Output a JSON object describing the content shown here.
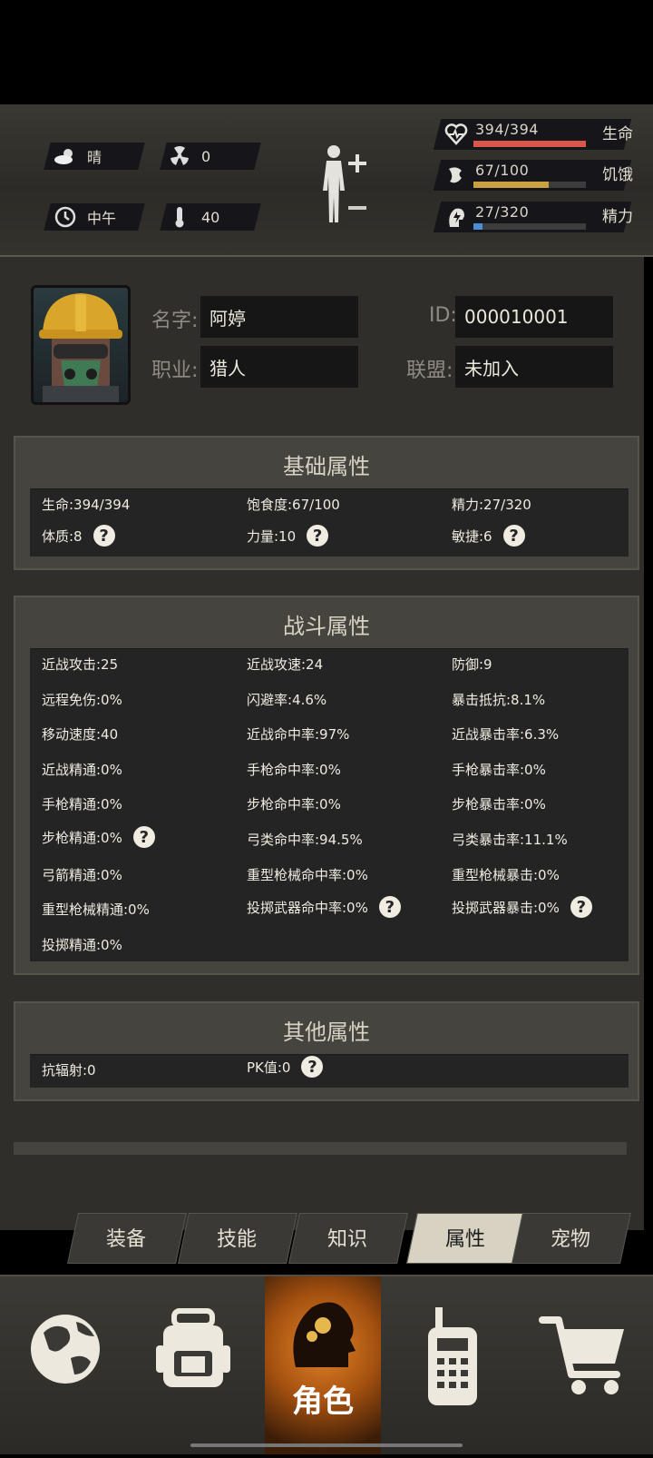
{
  "status": {
    "weather": {
      "icon": "cloud-sun-icon",
      "label": "晴"
    },
    "radiation": {
      "icon": "radiation-icon",
      "value": "0"
    },
    "time": {
      "icon": "clock-icon",
      "label": "中午"
    },
    "temperature": {
      "icon": "thermometer-icon",
      "value": "40"
    }
  },
  "vitals": [
    {
      "icon": "heart-icon",
      "value": "394/394",
      "label": "生命",
      "fill": 1.0,
      "color": "#d9574a"
    },
    {
      "icon": "hunger-icon",
      "value": "67/100",
      "label": "饥饿",
      "fill": 0.67,
      "color": "#c9a23f"
    },
    {
      "icon": "energy-icon",
      "value": "27/320",
      "label": "精力",
      "fill": 0.084,
      "color": "#4b8ed1"
    }
  ],
  "profile": {
    "name_label": "名字:",
    "name": "阿婷",
    "id_label": "ID:",
    "id": "000010001",
    "job_label": "职业:",
    "job": "猎人",
    "alliance_label": "联盟:",
    "alliance": "未加入"
  },
  "basic": {
    "title": "基础属性",
    "rows": [
      [
        "生命:394/394",
        "饱食度:67/100",
        "精力:27/320"
      ],
      [
        "体质:8",
        "力量:10",
        "敏捷:6"
      ]
    ]
  },
  "combat": {
    "title": "战斗属性",
    "rows": [
      [
        "近战攻击:25",
        "近战攻速:24",
        "防御:9"
      ],
      [
        "远程免伤:0%",
        "闪避率:4.6%",
        "暴击抵抗:8.1%"
      ],
      [
        "移动速度:40",
        "近战命中率:97%",
        "近战暴击率:6.3%"
      ],
      [
        "近战精通:0%",
        "手枪命中率:0%",
        "手枪暴击率:0%"
      ],
      [
        "手枪精通:0%",
        "步枪命中率:0%",
        "步枪暴击率:0%"
      ],
      [
        "步枪精通:0%",
        "弓类命中率:94.5%",
        "弓类暴击率:11.1%"
      ],
      [
        "弓箭精通:0%",
        "重型枪械命中率:0%",
        "重型枪械暴击:0%"
      ],
      [
        "重型枪械精通:0%",
        "投掷武器命中率:0%",
        "投掷武器暴击:0%"
      ],
      [
        "投掷精通:0%"
      ]
    ]
  },
  "other": {
    "title": "其他属性",
    "rows": [
      [
        "抗辐射:0",
        "PK值:0"
      ]
    ]
  },
  "subtabs": [
    "装备",
    "技能",
    "知识",
    "属性",
    "宠物"
  ],
  "active_subtab": "属性",
  "nav": [
    {
      "icon": "globe-icon",
      "label": ""
    },
    {
      "icon": "backpack-icon",
      "label": ""
    },
    {
      "icon": "character-head-icon",
      "label": "角色"
    },
    {
      "icon": "walkie-talkie-icon",
      "label": ""
    },
    {
      "icon": "cart-icon",
      "label": ""
    }
  ]
}
